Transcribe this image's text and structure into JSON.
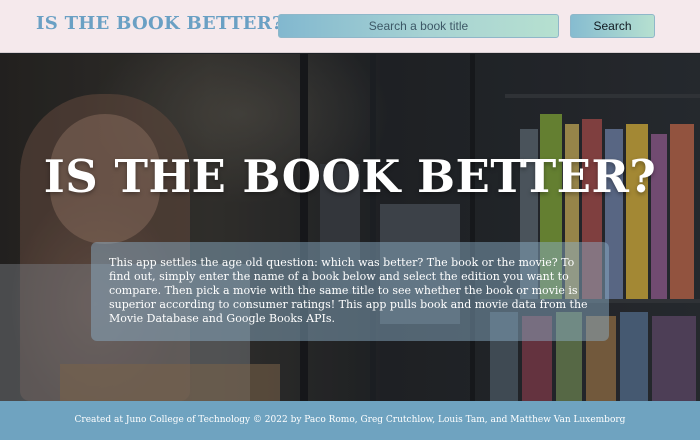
{
  "header": {
    "logo": "IS THE BOOK BETTER?",
    "search": {
      "placeholder": "Search a book title",
      "value": ""
    },
    "search_button": "Search"
  },
  "hero": {
    "title": "IS THE BOOK BETTER?",
    "intro": "This app settles the age old question: which was better? The book or the movie? To find out, simply enter the name of a book below and select the edition you want to compare. Then pick a movie with the same title to see whether the book or movie is superior according to consumer ratings! This app pulls book and movie data from the Movie Database and Google Books APIs."
  },
  "footer": {
    "credits": "Created at Juno College of Technology © 2022 by Paco Romo, Greg Crutchlow, Louis Tam, and Matthew Van Luxemborg"
  },
  "colors": {
    "accent": "#6aa0c4",
    "header_bg": "#f5e9ec",
    "footer_bg": "#6fa3c0"
  }
}
